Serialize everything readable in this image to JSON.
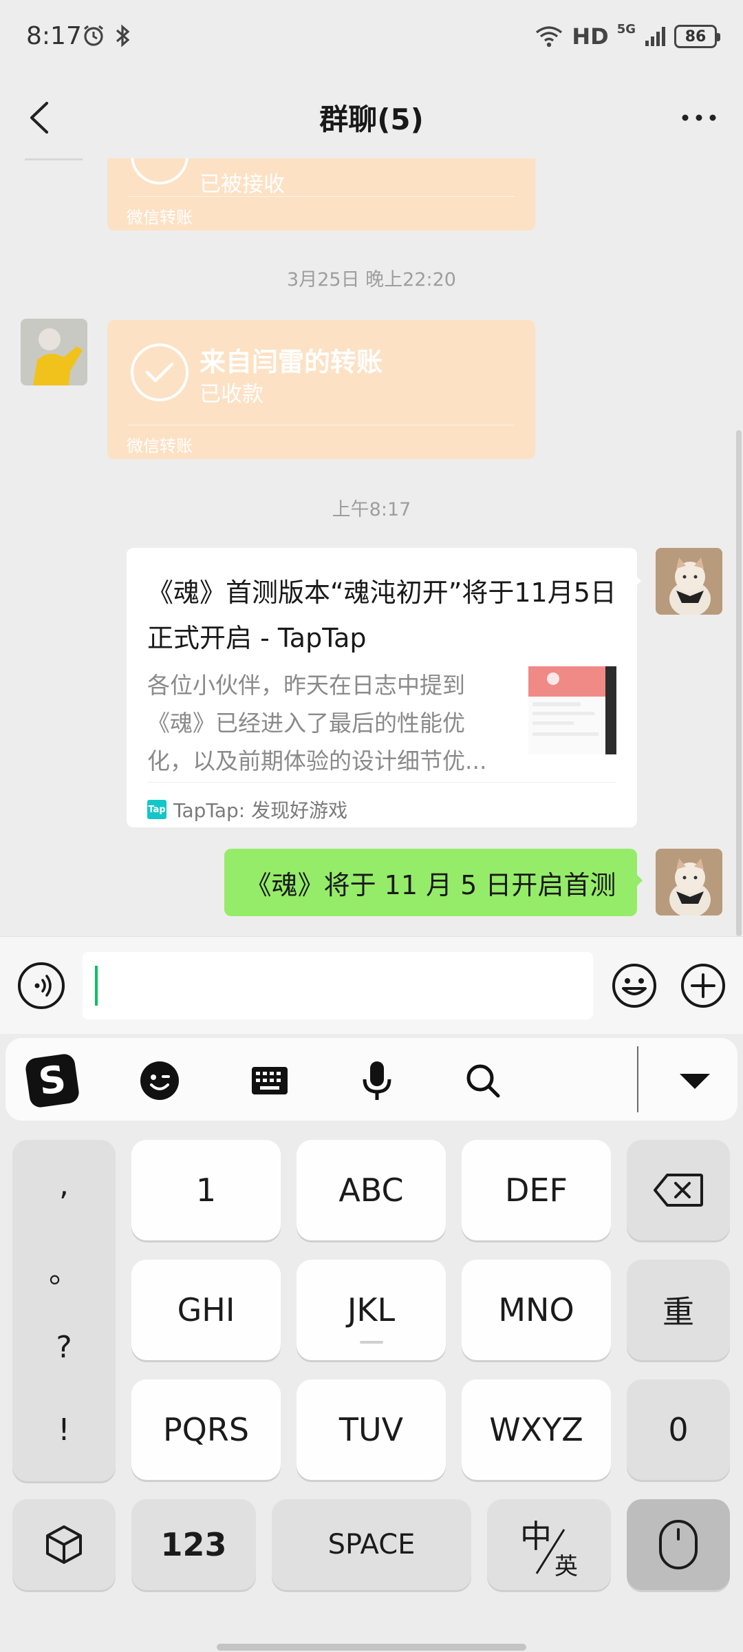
{
  "status_bar": {
    "time": "8:17",
    "network": "HD",
    "network_gen": "5G",
    "battery": "86"
  },
  "header": {
    "title": "群聊(5)"
  },
  "messages": {
    "transfer1": {
      "status": "已被接收",
      "footer": "微信转账"
    },
    "timestamp1": "3月25日 晚上22:20",
    "transfer2": {
      "title": "来自闫雷的转账",
      "status": "已收款",
      "footer": "微信转账"
    },
    "timestamp2": "上午8:17",
    "link_card": {
      "title": "《魂》首测版本“魂沌初开”将于11月5日正式开启 - TapTap",
      "description": "各位小伙伴，昨天在日志中提到《魂》已经进入了最后的性能优化，以及前期体验的设计细节优...",
      "source": "TapTap: 发现好游戏",
      "logo_text": "Tap"
    },
    "text_message": "《魂》将于 11 月 5 日开启首测"
  },
  "input_bar": {
    "value": ""
  },
  "keyboard": {
    "punctuation": [
      ",",
      "。",
      "?",
      "!"
    ],
    "row1": [
      "1",
      "ABC",
      "DEF"
    ],
    "row2": [
      "GHI",
      "JKL",
      "MNO"
    ],
    "row3": [
      "PQRS",
      "TUV",
      "WXYZ"
    ],
    "reset_label": "重",
    "zero_label": "0",
    "num_label": "123",
    "space_label": "SPACE",
    "lang_main": "中",
    "lang_sub": "英"
  },
  "colors": {
    "accent_green": "#07c160",
    "bubble_green": "#95ec69",
    "transfer_orange": "#fde1c4"
  }
}
